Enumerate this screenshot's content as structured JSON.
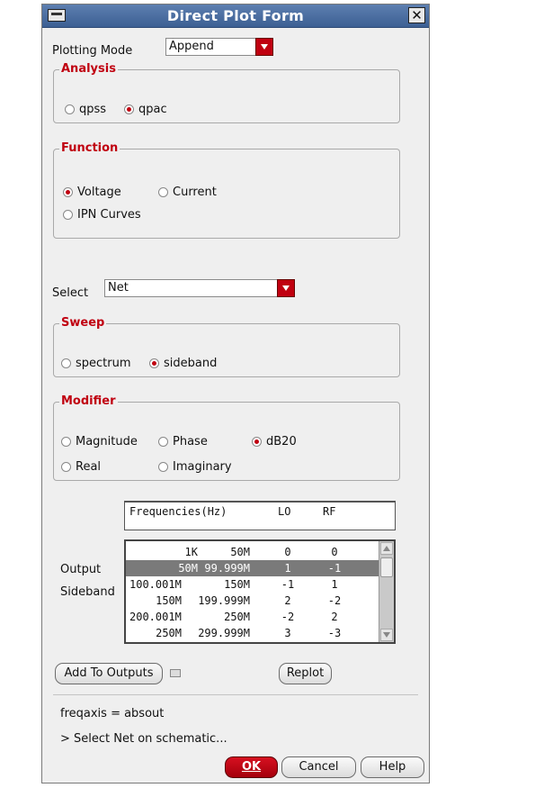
{
  "window": {
    "title": "Direct Plot Form"
  },
  "plotting_mode": {
    "label": "Plotting Mode",
    "value": "Append"
  },
  "analysis": {
    "title": "Analysis",
    "options": [
      "qpss",
      "qpac"
    ],
    "selected": "qpac"
  },
  "function": {
    "title": "Function",
    "options": [
      "Voltage",
      "Current",
      "IPN Curves"
    ],
    "selected": "Voltage"
  },
  "select": {
    "label": "Select",
    "value": "Net"
  },
  "sweep": {
    "title": "Sweep",
    "options": [
      "spectrum",
      "sideband"
    ],
    "selected": "sideband"
  },
  "modifier": {
    "title": "Modifier",
    "options": [
      "Magnitude",
      "Phase",
      "dB20",
      "Real",
      "Imaginary"
    ],
    "selected": "dB20"
  },
  "output_sideband": {
    "label_line1": "Output",
    "label_line2": "Sideband",
    "headers": [
      "Frequencies(Hz)",
      "LO",
      "RF"
    ],
    "rows": [
      {
        "freq_lo": "1K",
        "freq_hi": "50M",
        "lo": "0",
        "rf": "0"
      },
      {
        "freq_lo": "50M",
        "freq_hi": "99.999M",
        "lo": "1",
        "rf": "-1"
      },
      {
        "freq_lo": "100.001M",
        "freq_hi": "150M",
        "lo": "-1",
        "rf": "1"
      },
      {
        "freq_lo": "150M",
        "freq_hi": "199.999M",
        "lo": "2",
        "rf": "-2"
      },
      {
        "freq_lo": "200.001M",
        "freq_hi": "250M",
        "lo": "-2",
        "rf": "2"
      },
      {
        "freq_lo": "250M",
        "freq_hi": "299.999M",
        "lo": "3",
        "rf": "-3"
      }
    ],
    "selected_row": 1
  },
  "buttons": {
    "add_to_outputs": "Add To Outputs",
    "replot": "Replot",
    "ok": "OK",
    "cancel": "Cancel",
    "help": "Help"
  },
  "status": {
    "line1": "freqaxis = absout",
    "line2": "> Select Net on schematic..."
  },
  "colors": {
    "accent": "#c00010",
    "titlebar": "#4a6ea3"
  }
}
